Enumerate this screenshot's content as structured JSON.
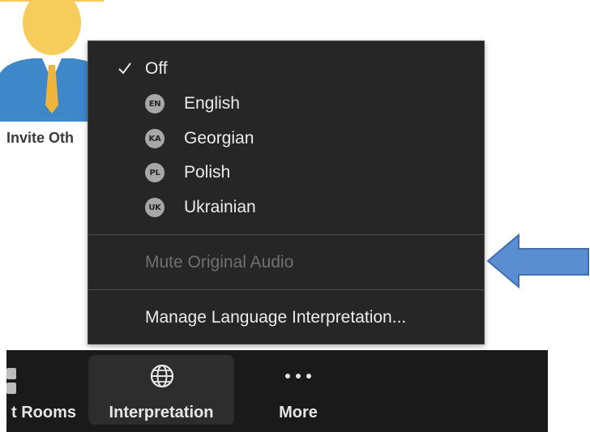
{
  "background": {
    "invite_label": "Invite Oth"
  },
  "menu": {
    "off_label": "Off",
    "languages": [
      {
        "badge": "EN",
        "label": "English"
      },
      {
        "badge": "KA",
        "label": "Georgian"
      },
      {
        "badge": "PL",
        "label": "Polish"
      },
      {
        "badge": "UK",
        "label": "Ukrainian"
      }
    ],
    "mute_label": "Mute Original Audio",
    "manage_label": "Manage Language Interpretation..."
  },
  "toolbar": {
    "rooms_label": "t Rooms",
    "interpretation_label": "Interpretation",
    "more_label": "More"
  },
  "colors": {
    "menu_bg": "#262626",
    "arrow_blue": "#5b8ed0",
    "toolbar_bg": "#1a1a1a"
  },
  "icons": {
    "check": "check-icon",
    "globe": "globe-icon",
    "more": "more-dots-icon",
    "rooms": "breakout-rooms-icon"
  }
}
